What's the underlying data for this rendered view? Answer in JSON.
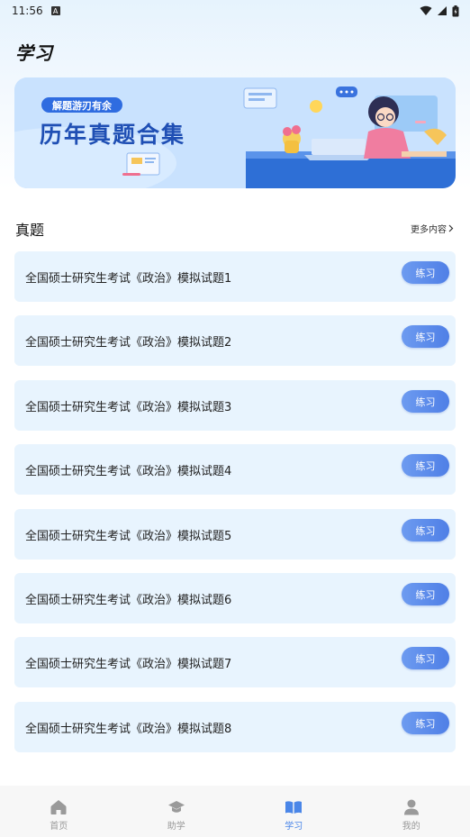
{
  "status_bar": {
    "time": "11:56",
    "notification_letter": "A"
  },
  "page": {
    "title": "学习"
  },
  "banner": {
    "pill_text": "解题游刃有余",
    "title": "历年真题合集"
  },
  "section": {
    "title": "真题",
    "more_label": "更多内容"
  },
  "items": [
    {
      "label": "全国硕士研究生考试《政治》模拟试题1",
      "button": "练习"
    },
    {
      "label": "全国硕士研究生考试《政治》模拟试题2",
      "button": "练习"
    },
    {
      "label": "全国硕士研究生考试《政治》模拟试题3",
      "button": "练习"
    },
    {
      "label": "全国硕士研究生考试《政治》模拟试题4",
      "button": "练习"
    },
    {
      "label": "全国硕士研究生考试《政治》模拟试题5",
      "button": "练习"
    },
    {
      "label": "全国硕士研究生考试《政治》模拟试题6",
      "button": "练习"
    },
    {
      "label": "全国硕士研究生考试《政治》模拟试题7",
      "button": "练习"
    },
    {
      "label": "全国硕士研究生考试《政治》模拟试题8",
      "button": "练习"
    }
  ],
  "nav": [
    {
      "label": "首页",
      "icon": "home-icon",
      "active": false
    },
    {
      "label": "助学",
      "icon": "graduation-cap-icon",
      "active": false
    },
    {
      "label": "学习",
      "icon": "book-icon",
      "active": true
    },
    {
      "label": "我的",
      "icon": "user-icon",
      "active": false
    }
  ],
  "colors": {
    "accent": "#4a86e8",
    "item_bg": "#e8f4fe",
    "banner_title": "#1f4fb4"
  }
}
